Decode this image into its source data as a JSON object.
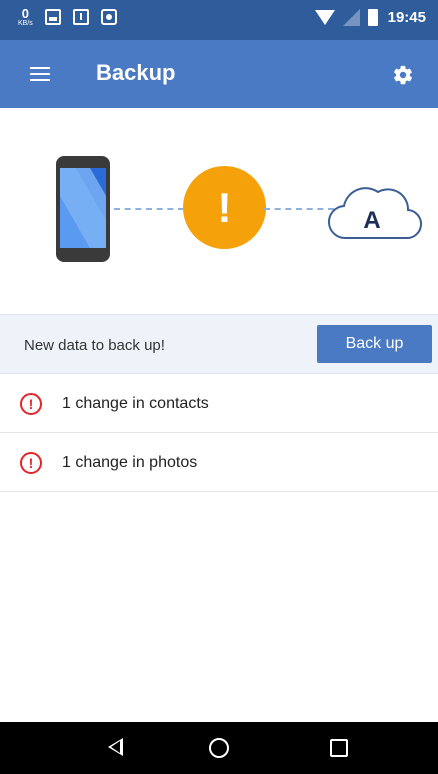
{
  "status_bar": {
    "speed_value": "0",
    "speed_unit": "KB/s",
    "time": "19:45",
    "icons": [
      "image-icon",
      "download-icon",
      "briefcase-icon",
      "wifi-icon",
      "signal-icon",
      "battery-icon"
    ]
  },
  "app_bar": {
    "title": "Backup",
    "menu_icon": "hamburger-icon",
    "settings_icon": "gear-icon"
  },
  "illustration": {
    "warning_symbol": "!",
    "cloud_letter": "A"
  },
  "backup_bar": {
    "message": "New data to back up!",
    "button_label": "Back up"
  },
  "changes": [
    {
      "text": "1 change in contacts"
    },
    {
      "text": "1 change in photos"
    }
  ],
  "colors": {
    "status_bar": "#2f5d9c",
    "app_bar": "#4a7ac4",
    "warning": "#f5a20a",
    "error": "#e3242b",
    "accent_button": "#4a7ac4"
  }
}
